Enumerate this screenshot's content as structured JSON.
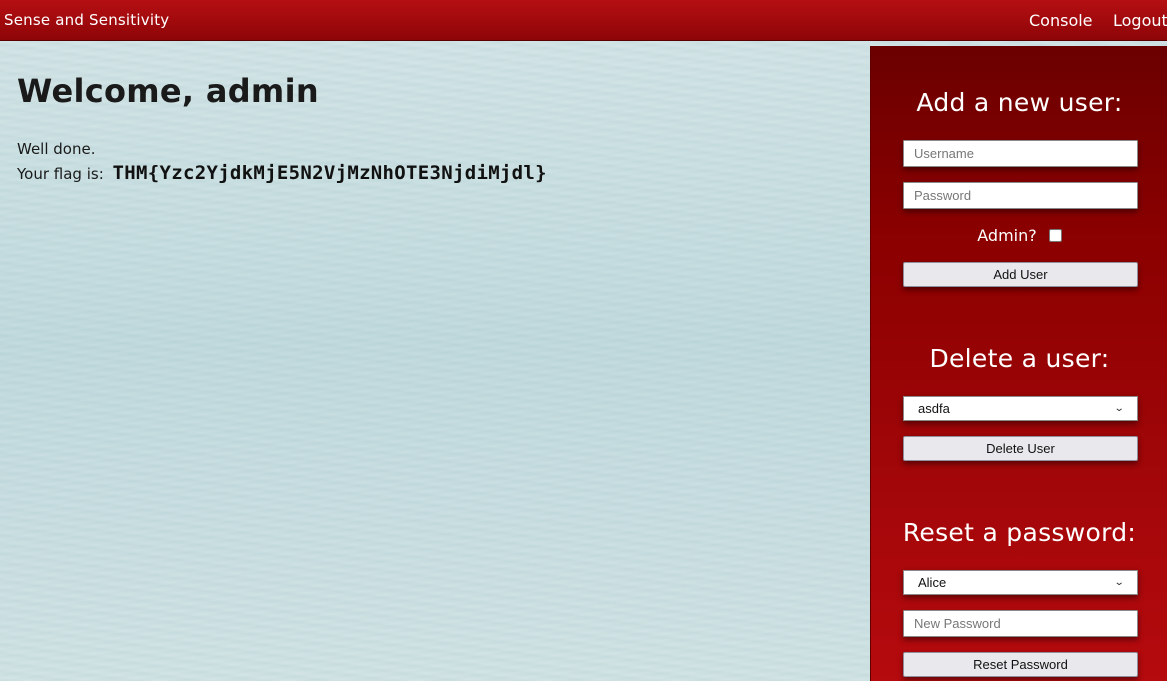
{
  "navbar": {
    "brand": "Sense and Sensitivity",
    "console_label": "Console",
    "logout_label": "Logout",
    "bar_color": "#a00a0d"
  },
  "main": {
    "welcome": "Welcome, admin",
    "well_done": "Well done.",
    "flag_prefix": "Your flag is:",
    "flag": "THM{Yzc2YjdkMjE5N2VjMzNhOTE3NjdiMjdl}"
  },
  "sidebar": {
    "add_user": {
      "title": "Add a new user:",
      "username_placeholder": "Username",
      "password_placeholder": "Password",
      "admin_label": "Admin?",
      "admin_checked": false,
      "button": "Add User"
    },
    "delete_user": {
      "title": "Delete a user:",
      "selected": "asdfa",
      "button": "Delete User"
    },
    "reset_password": {
      "title": "Reset a password:",
      "selected": "Alice",
      "new_password_placeholder": "New Password",
      "button": "Reset Password"
    }
  },
  "icons": {
    "select_chevron": "chevron-down-icon"
  }
}
